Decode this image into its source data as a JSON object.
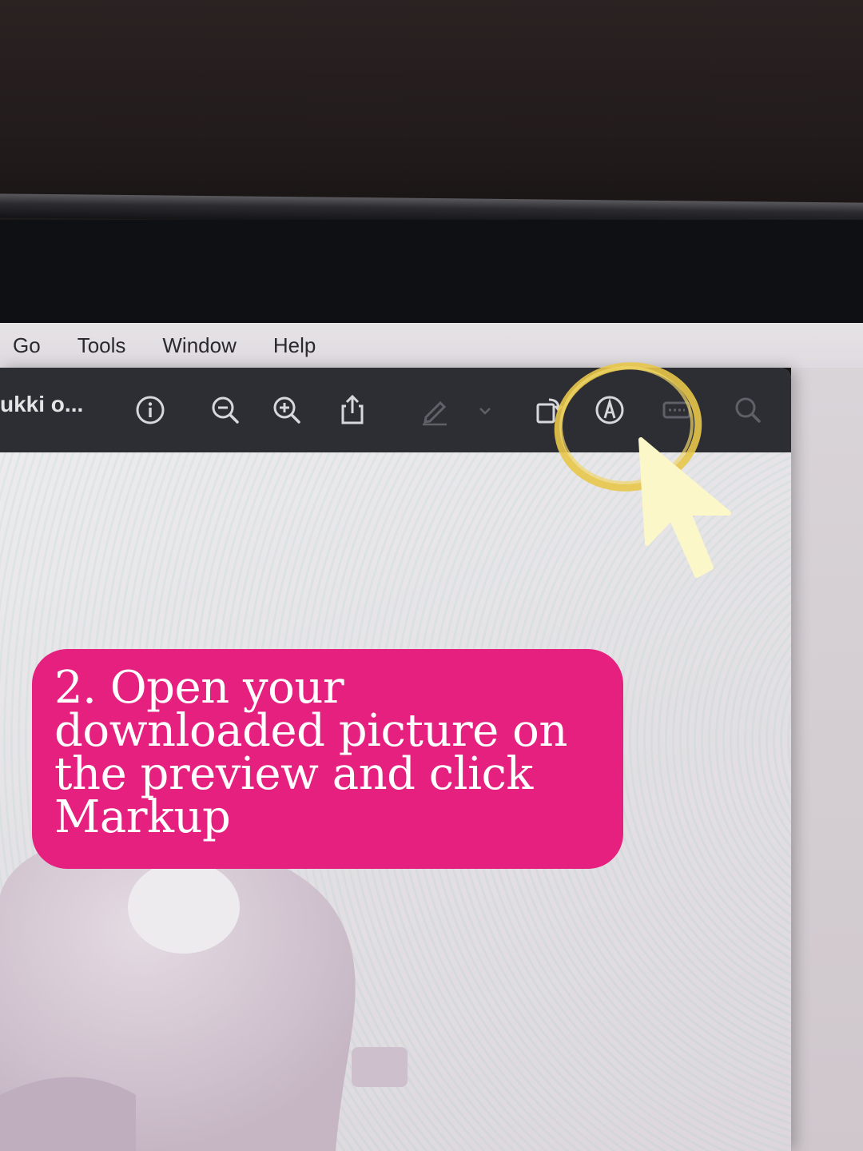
{
  "menubar": {
    "items": [
      "Go",
      "Tools",
      "Window",
      "Help"
    ]
  },
  "toolbar": {
    "document_title": "ukki o...",
    "icons": [
      "info-icon",
      "zoom-out-icon",
      "zoom-in-icon",
      "share-icon",
      "highlight-pen-icon",
      "chevron-down-icon",
      "rotate-icon",
      "markup-icon",
      "form-icon",
      "search-icon"
    ]
  },
  "callout": {
    "text": "2. Open your downloaded picture on the preview and click Markup",
    "color": "#e5207f"
  },
  "annotation": {
    "ring_color": "#e8c64a",
    "pointer_color": "#fbf7c8"
  }
}
